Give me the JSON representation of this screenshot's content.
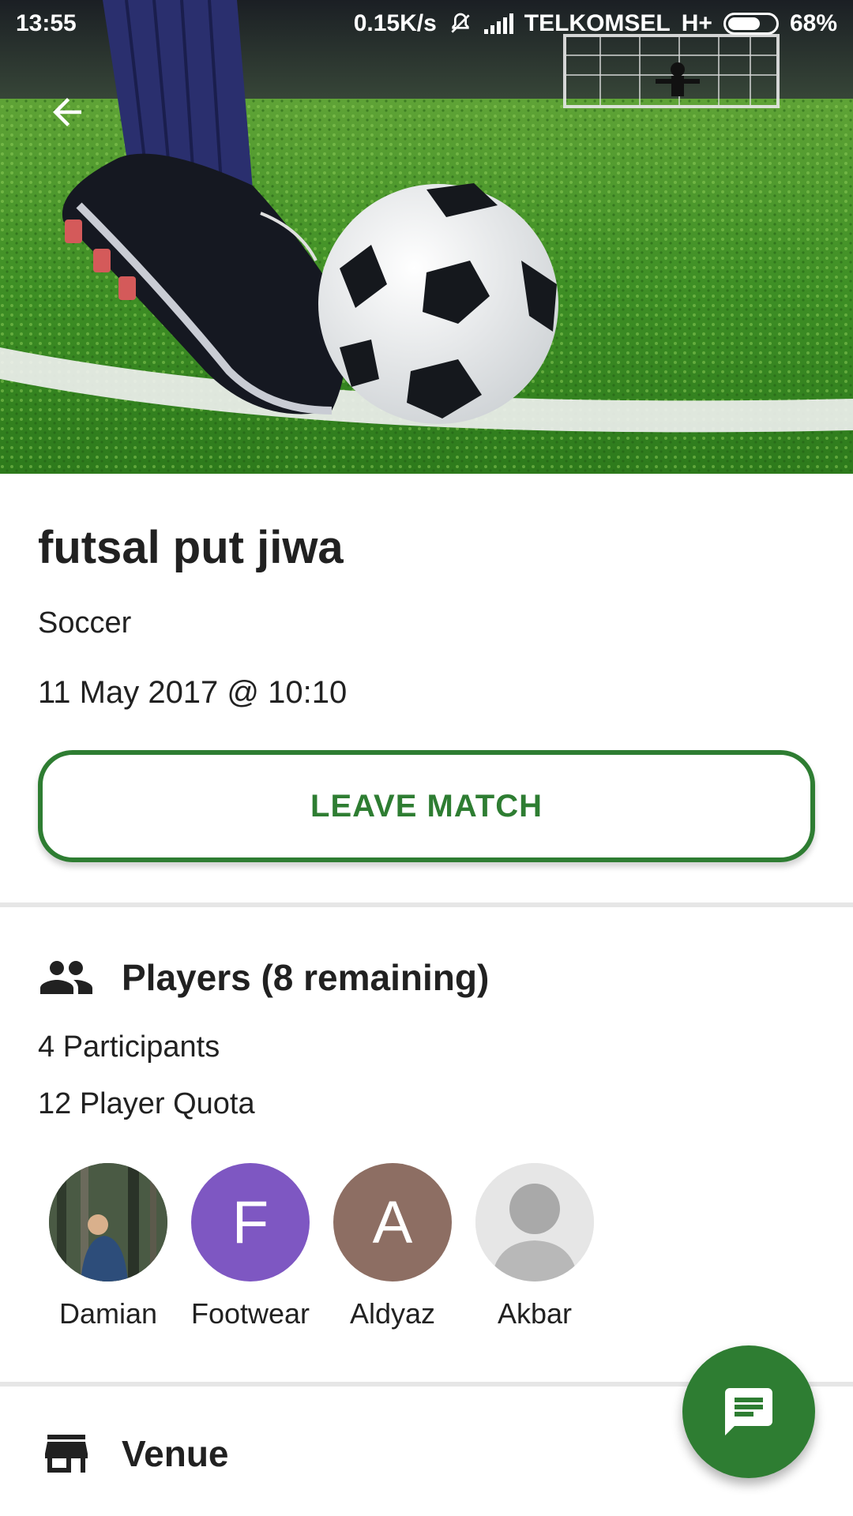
{
  "status_bar": {
    "time": "13:55",
    "network_speed": "0.15K/s",
    "carrier": "TELKOMSEL",
    "network_type": "H+",
    "battery": "68%"
  },
  "match": {
    "title": "futsal put jiwa",
    "sport": "Soccer",
    "datetime": "11 May 2017 @ 10:10",
    "leave_label": "LEAVE MATCH"
  },
  "players_section": {
    "heading": "Players (8 remaining)",
    "participants": "4 Participants",
    "quota": "12 Player Quota",
    "players": [
      {
        "name": "Damian",
        "initial": "",
        "type": "photo"
      },
      {
        "name": "Footwear",
        "initial": "F",
        "type": "initial",
        "color": "#7e57c2"
      },
      {
        "name": "Aldyaz",
        "initial": "A",
        "type": "initial",
        "color": "#8d6e63"
      },
      {
        "name": "Akbar",
        "initial": "",
        "type": "placeholder"
      }
    ]
  },
  "venue_section": {
    "heading": "Venue"
  },
  "icons": {
    "back": "arrow-back-icon",
    "players": "people-icon",
    "venue": "store-icon",
    "chat": "chat-icon"
  },
  "colors": {
    "accent": "#2e7d32",
    "divider": "#e6e6e6"
  }
}
